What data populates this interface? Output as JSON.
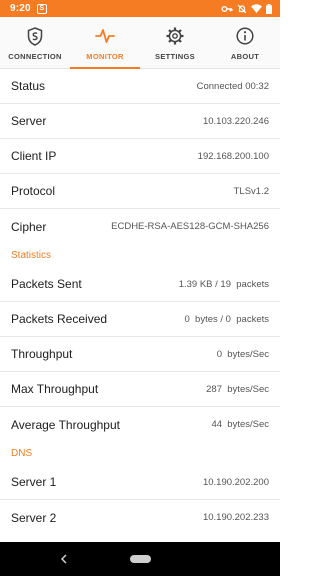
{
  "statusbar": {
    "time": "9:20",
    "app_notification_glyph": "S"
  },
  "tabs": [
    {
      "label": "CONNECTION",
      "icon": "shield-s-icon",
      "active": false
    },
    {
      "label": "MONITOR",
      "icon": "pulse-icon",
      "active": true
    },
    {
      "label": "SETTINGS",
      "icon": "gear-icon",
      "active": false
    },
    {
      "label": "ABOUT",
      "icon": "info-icon",
      "active": false
    }
  ],
  "connection": {
    "status_label": "Status",
    "status_value": "Connected 00:32",
    "server_label": "Server",
    "server_value": "10.103.220.246",
    "client_ip_label": "Client IP",
    "client_ip_value": "192.168.200.100",
    "protocol_label": "Protocol",
    "protocol_value": "TLSv1.2",
    "cipher_label": "Cipher",
    "cipher_value": "ECDHE-RSA-AES128-GCM-SHA256"
  },
  "statistics": {
    "header": "Statistics",
    "packets_sent_label": "Packets Sent",
    "packets_sent_value": "1.39 KB / 19  packets",
    "packets_received_label": "Packets Received",
    "packets_received_value": "0  bytes / 0  packets",
    "throughput_label": "Throughput",
    "throughput_value": "0  bytes/Sec",
    "max_throughput_label": "Max Throughput",
    "max_throughput_value": "287  bytes/Sec",
    "avg_throughput_label": "Average Throughput",
    "avg_throughput_value": "44  bytes/Sec"
  },
  "dns": {
    "header": "DNS",
    "server1_label": "Server 1",
    "server1_value": "10.190.202.200",
    "server2_label": "Server 2",
    "server2_value": "10.190.202.233"
  },
  "colors": {
    "accent": "#f57c22",
    "navbar": "#000000",
    "divider": "#e6e6e6"
  }
}
